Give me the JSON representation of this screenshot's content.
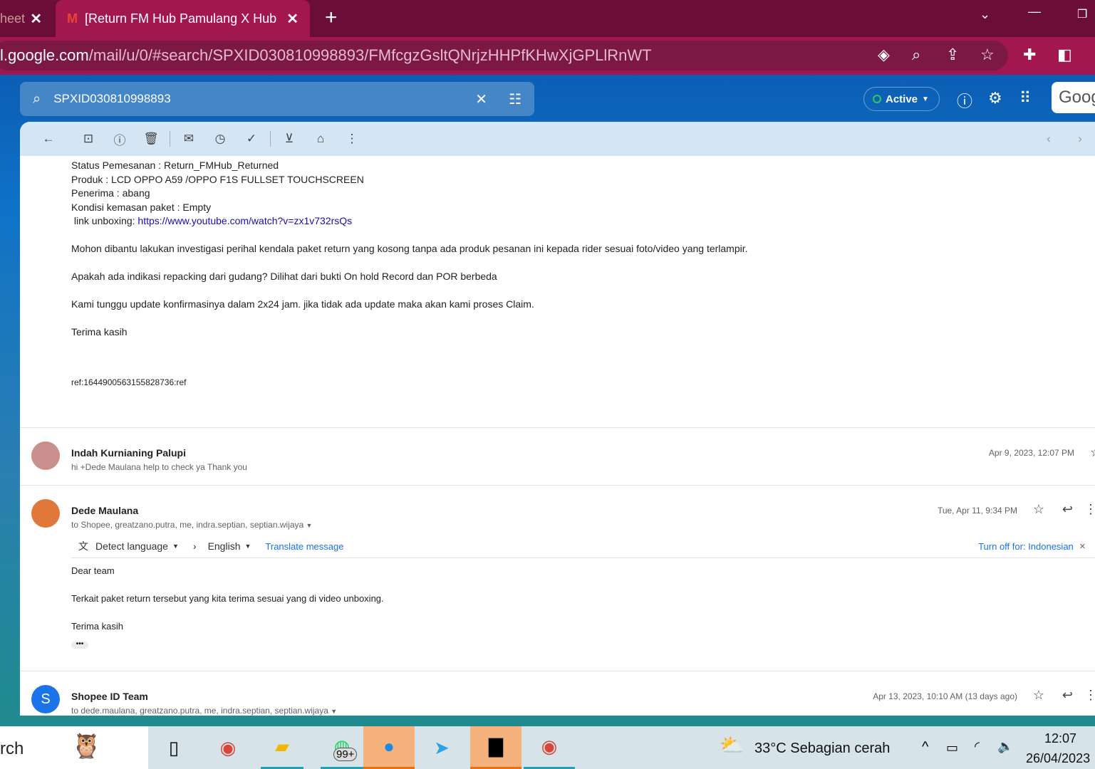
{
  "browser": {
    "tab_prev": "heet",
    "tab_active": "[Return FM Hub Pamulang X Hub",
    "url_host": "l.google.com",
    "url_path": "/mail/u/0/#search/SPXID030810998893/FMfcgzGsltQNrjzHHPfKHwXjGPLlRnWT"
  },
  "gmail": {
    "search_value": "SPXID030810998893",
    "status": "Active",
    "logo_text": "Goog"
  },
  "email1": {
    "lines": [
      "Status Pemesanan : Return_FMHub_Returned",
      "Produk : LCD OPPO A59 /OPPO F1S FULLSET TOUCHSCREEN",
      "Penerima : abang",
      "Kondisi kemasan paket : Empty"
    ],
    "link_label": " link unboxing: ",
    "link": "https://www.youtube.com/watch?v=zx1v732rsQs",
    "p1": "Mohon dibantu lakukan investigasi perihal kendala paket return yang kosong tanpa ada produk pesanan ini kepada rider sesuai foto/video yang terlampir.",
    "p2": "Apakah ada indikasi repacking dari gudang? Dilihat dari bukti On hold Record dan POR berbeda",
    "p3": "Kami tunggu update konfirmasinya dalam 2x24 jam. jika tidak ada update maka akan kami proses Claim.",
    "p4": "Terima kasih",
    "ref": "ref:1644900563155828736:ref"
  },
  "email2": {
    "sender": "Indah Kurnianing Palupi",
    "snippet": "hi +Dede Maulana help to check ya Thank you",
    "date": "Apr 9, 2023, 12:07 PM"
  },
  "email3": {
    "sender": "Dede Maulana",
    "to": "to Shopee, greatzano.putra, me, indra.septian, septian.wijaya",
    "date": "Tue, Apr 11, 9:34 PM",
    "detect": "Detect language",
    "lang": "English",
    "translate": "Translate message",
    "turnoff": "Turn off for: Indonesian",
    "p1": "Dear team",
    "p2": "Terkait paket return tersebut yang kita terima sesuai yang di video unboxing.",
    "p3": "Terima kasih"
  },
  "email4": {
    "avatar": "S",
    "sender": "Shopee ID Team",
    "to": "to dede.maulana, greatzano.putra, me, indra.septian, septian.wijaya",
    "date": "Apr 13, 2023, 10:10 AM (13 days ago)"
  },
  "taskbar": {
    "search": "rch",
    "badge": "99+",
    "weather": "33°C  Sebagian cerah",
    "time": "12:07",
    "date": "26/04/2023"
  }
}
